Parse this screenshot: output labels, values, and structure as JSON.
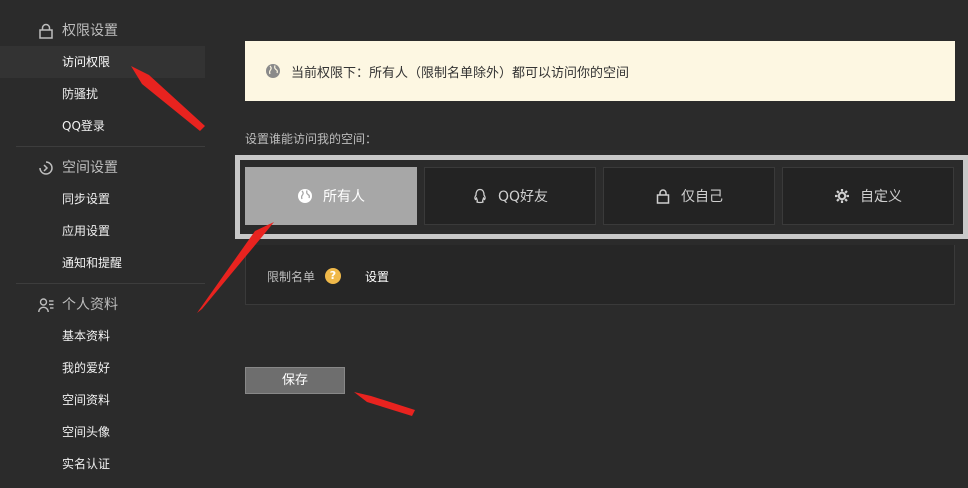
{
  "sidebar": {
    "sections": [
      {
        "title": "权限设置",
        "icon": "lock-icon",
        "items": [
          {
            "label": "访问权限",
            "active": true
          },
          {
            "label": "防骚扰"
          },
          {
            "label": "QQ登录"
          }
        ]
      },
      {
        "title": "空间设置",
        "icon": "space-icon",
        "items": [
          {
            "label": "同步设置"
          },
          {
            "label": "应用设置"
          },
          {
            "label": "通知和提醒"
          }
        ]
      },
      {
        "title": "个人资料",
        "icon": "user-profile-icon",
        "items": [
          {
            "label": "基本资料"
          },
          {
            "label": "我的爱好"
          },
          {
            "label": "空间资料"
          },
          {
            "label": "空间头像"
          },
          {
            "label": "实名认证"
          }
        ]
      }
    ]
  },
  "notice": {
    "text": "当前权限下：所有人（限制名单除外）都可以访问你的空间",
    "icon": "globe-icon"
  },
  "access": {
    "label": "设置谁能访问我的空间：",
    "options": [
      {
        "label": "所有人",
        "icon": "globe-icon",
        "selected": true
      },
      {
        "label": "QQ好友",
        "icon": "qq-penguin-icon"
      },
      {
        "label": "仅自己",
        "icon": "lock-icon"
      },
      {
        "label": "自定义",
        "icon": "gear-icon"
      }
    ]
  },
  "blacklist": {
    "label": "限制名单",
    "help": "?",
    "action": "设置"
  },
  "save": {
    "label": "保存"
  },
  "colors": {
    "background": "#2b2b2b",
    "notice_bg": "#fdf7e2",
    "selected_option": "#a7a7a7",
    "annotation_arrow": "#e8231f"
  }
}
